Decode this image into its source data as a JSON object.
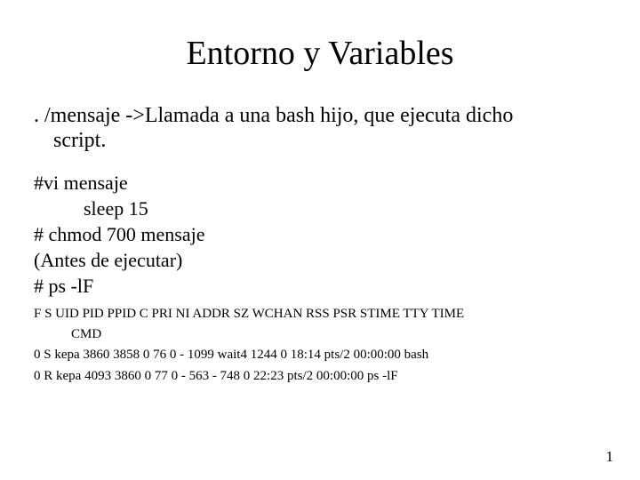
{
  "title": "Entorno y Variables",
  "lead_line1": ". /mensaje ->Llamada a una bash hijo, que ejecuta dicho",
  "lead_line2": "script.",
  "code": {
    "l1": "#vi mensaje",
    "l2": "sleep 15",
    "l3": "# chmod 700 mensaje",
    "l4": "(Antes de ejecutar)",
    "l5": "#  ps -lF"
  },
  "ps_header_main": "F S UID          PID  PPID  C PRI  NI ADDR SZ WCHAN   RSS PSR STIME TTY           TIME",
  "ps_header_cmd": "CMD",
  "ps_row1": "0 S kepa       3860  3858  0  76   0 -  1099 wait4  1244   0 18:14 pts/2    00:00:00 bash",
  "ps_row2": "0 R kepa       4093  3860  0  77   0 -   563 -          748   0 22:23 pts/2    00:00:00 ps -lF",
  "page_number": "1"
}
